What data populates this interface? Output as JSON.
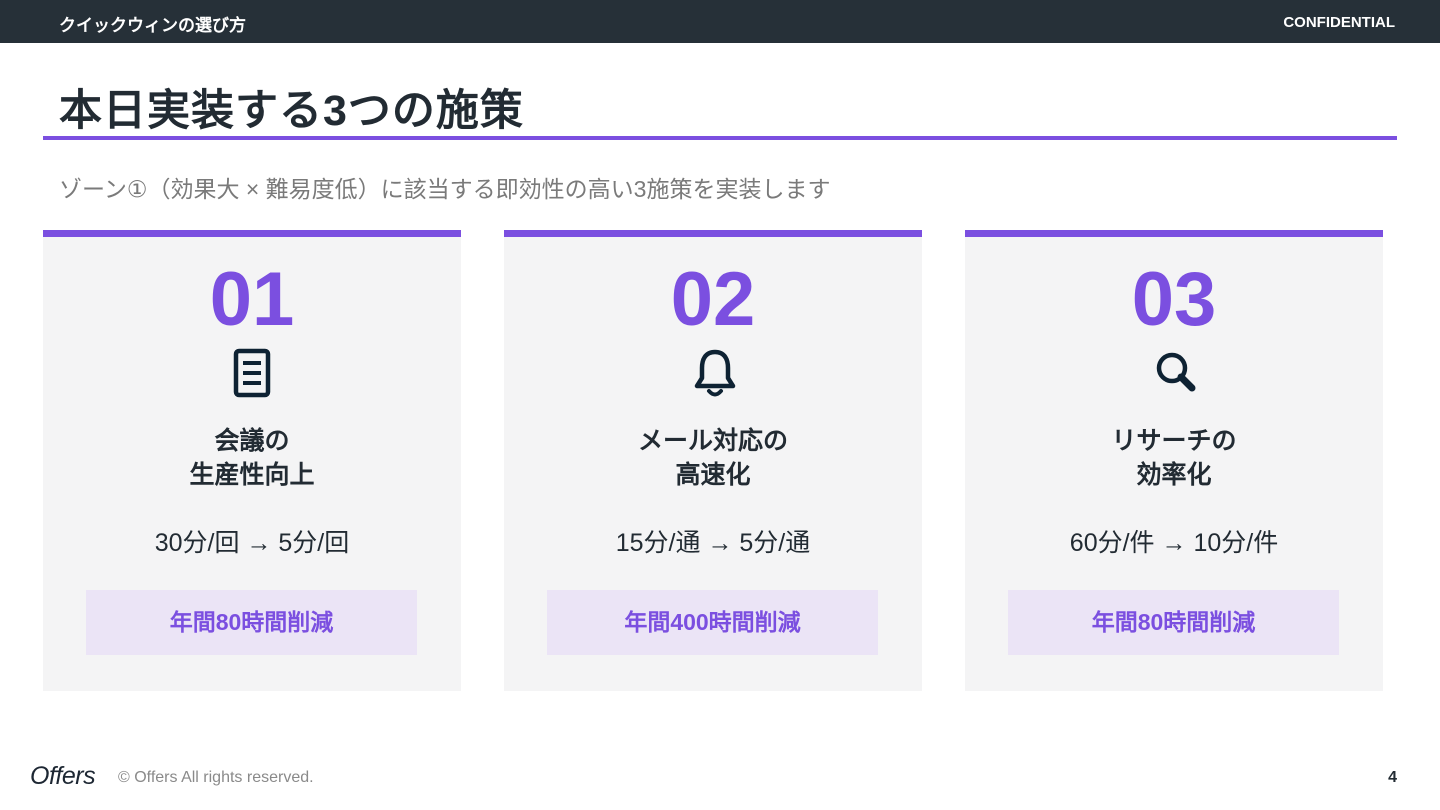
{
  "header": {
    "section": "クイックウィンの選び方",
    "confidential": "CONFIDENTIAL"
  },
  "title": "本日実装する3つの施策",
  "subtitle": "ゾーン①（効果大 × 難易度低）に該当する即効性の高い3施策を実装します",
  "cards": [
    {
      "number": "01",
      "icon": "document-icon",
      "name_line1": "会議の",
      "name_line2": "生産性向上",
      "metric": "30分/回 → 5分/回",
      "badge": "年間80時間削減"
    },
    {
      "number": "02",
      "icon": "bell-icon",
      "name_line1": "メール対応の",
      "name_line2": "高速化",
      "metric": "15分/通 → 5分/通",
      "badge": "年間400時間削減"
    },
    {
      "number": "03",
      "icon": "search-icon",
      "name_line1": "リサーチの",
      "name_line2": "効率化",
      "metric": "60分/件 → 10分/件",
      "badge": "年間80時間削減"
    }
  ],
  "footer": {
    "logo": "Offers",
    "copyright": "© Offers All rights reserved.",
    "page": "4"
  },
  "colors": {
    "accent": "#7b4fe0",
    "header_bg": "#263038",
    "card_bg": "#f4f4f5",
    "badge_bg": "#ebe4f6"
  }
}
